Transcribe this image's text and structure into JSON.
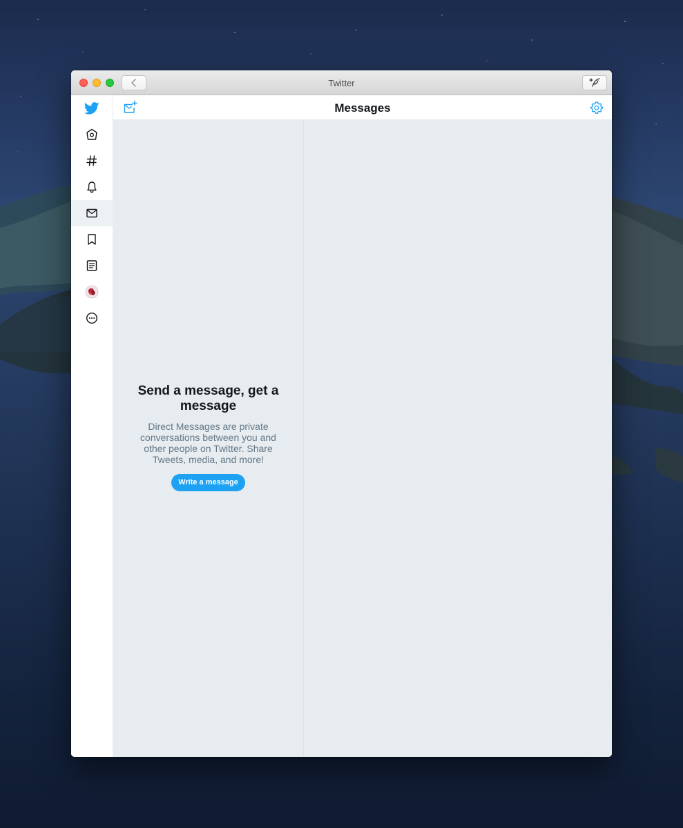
{
  "window": {
    "title": "Twitter"
  },
  "sidebar": {
    "items": [
      {
        "name": "twitter-logo"
      },
      {
        "name": "home"
      },
      {
        "name": "explore"
      },
      {
        "name": "notifications"
      },
      {
        "name": "messages",
        "active": true
      },
      {
        "name": "bookmarks"
      },
      {
        "name": "lists"
      },
      {
        "name": "profile"
      },
      {
        "name": "more"
      }
    ]
  },
  "header": {
    "title": "Messages"
  },
  "empty_state": {
    "title": "Send a message, get a message",
    "body": "Direct Messages are private conversations between you and other people on Twitter. Share Tweets, media, and more!",
    "button_label": "Write a message"
  },
  "colors": {
    "accent": "#1da1f2",
    "pane_background": "#e6ecf0",
    "text_primary": "#14171a",
    "text_secondary": "#657786"
  }
}
